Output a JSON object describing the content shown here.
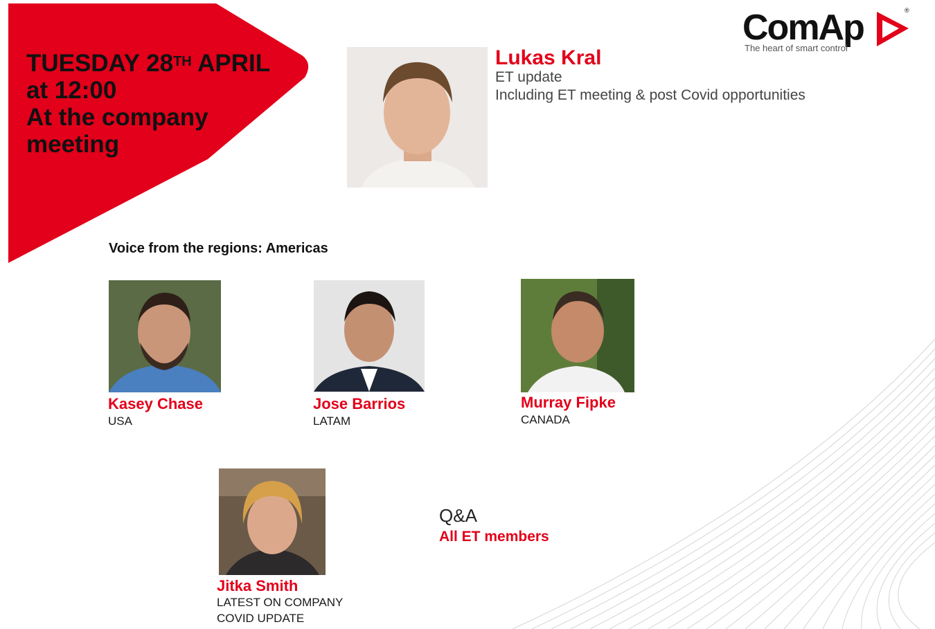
{
  "colors": {
    "brand_red": "#e2001a",
    "text": "#1a1a1a"
  },
  "banner": {
    "line1_a": "TUESDAY 28",
    "line1_sup": "TH",
    "line1_b": " APRIL",
    "line2": "at 12:00",
    "line3": "At the company",
    "line4": "meeting"
  },
  "logo": {
    "wordmark": "ComAp",
    "registered": "®",
    "tagline": "The heart of smart control",
    "icon": "play-arrow-icon"
  },
  "main_speaker": {
    "name": "Lukas Kral",
    "topic1": "ET update",
    "topic2": "Including ET meeting & post Covid opportunities"
  },
  "section_title": "Voice from the regions: Americas",
  "regional_speakers": [
    {
      "name": "Kasey Chase",
      "region": "USA"
    },
    {
      "name": "Jose Barrios",
      "region": "LATAM"
    },
    {
      "name": "Murray Fipke",
      "region": "CANADA"
    }
  ],
  "covid_speaker": {
    "name": "Jitka Smith",
    "line1": "LATEST ON COMPANY",
    "line2": "COVID UPDATE"
  },
  "qa": {
    "title": "Q&A",
    "members": "All ET members"
  }
}
